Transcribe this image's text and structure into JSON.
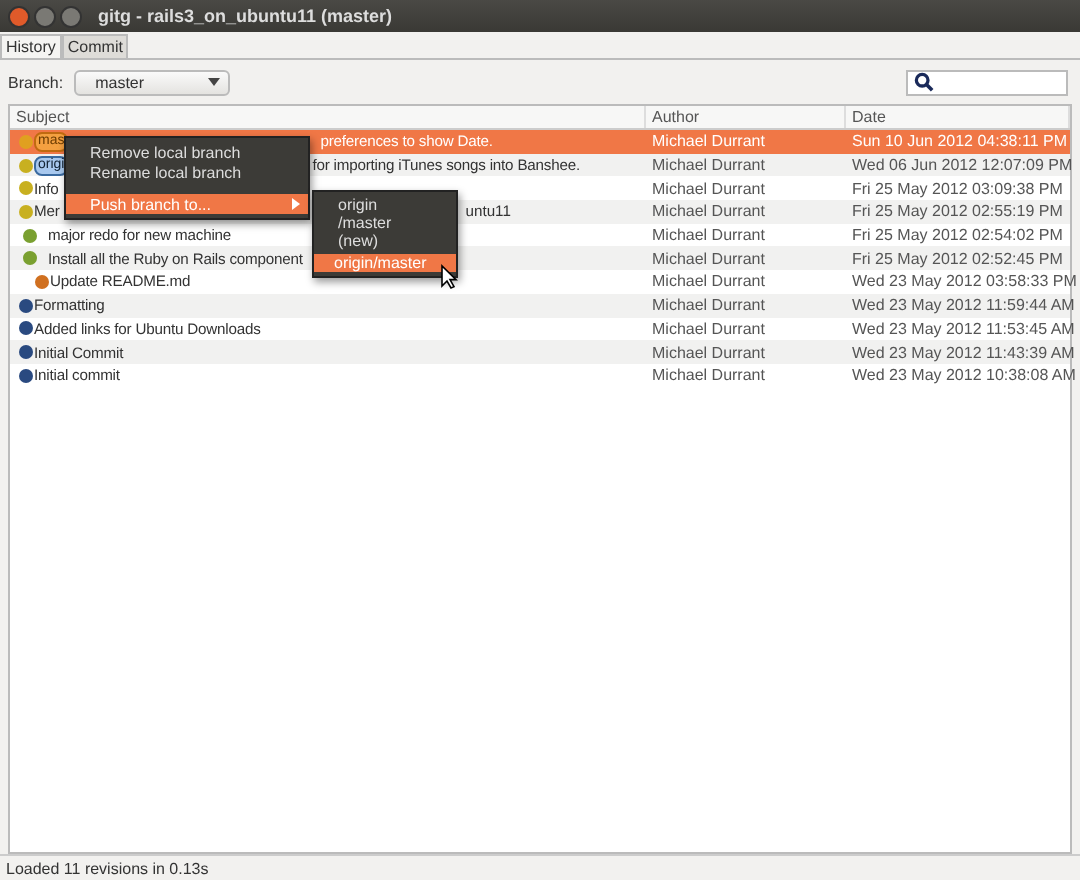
{
  "window": {
    "title": "gitg - rails3_on_ubuntu11 (master)"
  },
  "tabs": [
    {
      "label": "History",
      "selected": true
    },
    {
      "label": "Commit",
      "selected": false
    }
  ],
  "branch": {
    "label": "Branch:",
    "value": "master"
  },
  "table": {
    "columns": [
      "Subject",
      "Author",
      "Date"
    ],
    "rows": [
      {
        "kind": "main",
        "color": "#e0a020",
        "badge": {
          "text": "mas",
          "kind": "local"
        },
        "subject": "preferences to show Date.",
        "author": "Michael Durrant",
        "date": "Sun 10 Jun 2012 04:38:11 PM",
        "selected": true
      },
      {
        "kind": "main",
        "color": "#c8b020",
        "badge": {
          "text": "origi",
          "kind": "remote"
        },
        "subject": "for importing iTunes songs into Banshee.",
        "author": "Michael Durrant",
        "date": "Wed 06 Jun 2012 12:07:09 PM",
        "selected": false
      },
      {
        "kind": "main",
        "color": "#c8b020",
        "subject": "Info",
        "author": "Michael Durrant",
        "date": "Fri 25 May 2012 03:09:38 PM",
        "selected": false
      },
      {
        "kind": "main",
        "color": "#c8b020",
        "subject": "Mer",
        "subject_tail": "untu11",
        "author": "Michael Durrant",
        "date": "Fri 25 May 2012 02:55:19 PM",
        "selected": false
      },
      {
        "kind": "side",
        "color": "#7aa030",
        "subject": "major redo for new machine",
        "author": "Michael Durrant",
        "date": "Fri 25 May 2012 02:54:02 PM",
        "selected": false
      },
      {
        "kind": "side",
        "color": "#7aa030",
        "subject": "Install all the Ruby on Rails component",
        "author": "Michael Durrant",
        "date": "Fri 25 May 2012 02:52:45 PM",
        "selected": false
      },
      {
        "kind": "far",
        "color": "#d07020",
        "subject": "Update README.md",
        "author": "Michael Durrant",
        "date": "Wed 23 May 2012 03:58:33 PM",
        "selected": false
      },
      {
        "kind": "main",
        "color": "#2a4a80",
        "subject": "Formatting",
        "author": "Michael Durrant",
        "date": "Wed 23 May 2012 11:59:44 AM",
        "selected": false
      },
      {
        "kind": "main",
        "color": "#2a4a80",
        "subject": "Added links for Ubuntu Downloads",
        "author": "Michael Durrant",
        "date": "Wed 23 May 2012 11:53:45 AM",
        "selected": false
      },
      {
        "kind": "main",
        "color": "#2a4a80",
        "subject": "Initial Commit",
        "author": "Michael Durrant",
        "date": "Wed 23 May 2012 11:43:39 AM",
        "selected": false
      },
      {
        "kind": "main",
        "color": "#2a4a80",
        "subject": "Initial commit",
        "author": "Michael Durrant",
        "date": "Wed 23 May 2012 10:38:08 AM",
        "selected": false
      }
    ]
  },
  "context_menu": {
    "items": [
      {
        "label": "Remove local branch",
        "selected": false,
        "submenu": false
      },
      {
        "label": "Rename local branch",
        "selected": false,
        "submenu": false
      },
      {
        "label": "Push branch to...",
        "selected": true,
        "submenu": true
      }
    ]
  },
  "submenu": {
    "items": [
      {
        "label": "origin /master (new)",
        "selected": false
      },
      {
        "label": "origin/master",
        "selected": true
      }
    ]
  },
  "status_bar": "Loaded 11 revisions in 0.13s"
}
